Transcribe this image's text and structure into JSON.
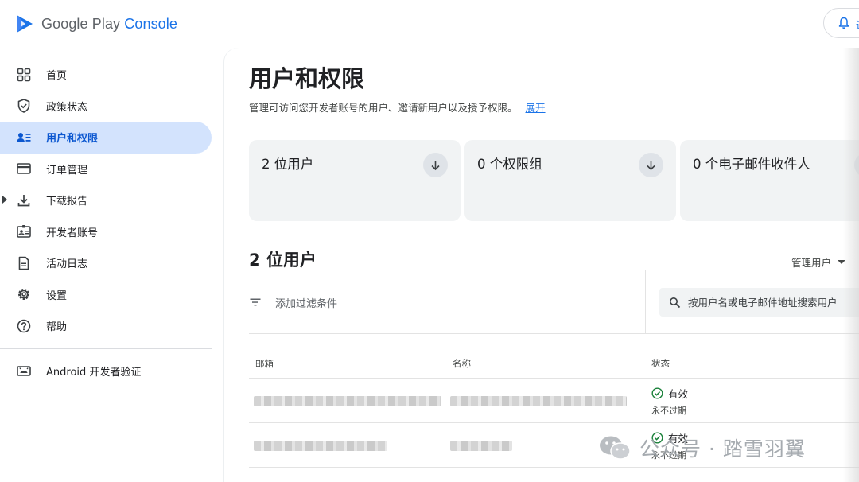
{
  "app": {
    "logo_text_main": "Google Play ",
    "logo_text_accent": "Console",
    "notification_label": "通"
  },
  "sidebar": {
    "items": [
      {
        "label": "首页",
        "icon": "grid-icon"
      },
      {
        "label": "政策状态",
        "icon": "shield-icon"
      },
      {
        "label": "用户和权限",
        "icon": "users-list-icon",
        "active": true
      },
      {
        "label": "订单管理",
        "icon": "credit-card-icon"
      },
      {
        "label": "下载报告",
        "icon": "download-icon",
        "expandable": true
      },
      {
        "label": "开发者账号",
        "icon": "id-card-icon"
      },
      {
        "label": "活动日志",
        "icon": "document-icon"
      },
      {
        "label": "设置",
        "icon": "gear-icon"
      },
      {
        "label": "帮助",
        "icon": "help-icon"
      }
    ],
    "footer_item": {
      "label": "Android 开发者验证",
      "icon": "android-icon"
    }
  },
  "main": {
    "title": "用户和权限",
    "description": "管理可访问您开发者账号的用户、邀请新用户以及授予权限。",
    "expand_link": "展开",
    "cards": [
      {
        "title": "2 位用户"
      },
      {
        "title": "0 个权限组"
      },
      {
        "title": "0 个电子邮件收件人"
      }
    ],
    "section_title": "2 位用户",
    "manage_users": "管理用户",
    "filter_label": "添加过滤条件",
    "search_placeholder": "按用户名或电子邮件地址搜索用户",
    "table": {
      "columns": [
        "邮箱",
        "名称",
        "状态"
      ],
      "rows": [
        {
          "status": "有效",
          "expiry": "永不过期"
        },
        {
          "status": "有效",
          "expiry": "永不过期"
        }
      ]
    }
  },
  "watermark": {
    "text": "公众号 · 踏雪羽翼"
  },
  "colors": {
    "accent": "#1a73e8",
    "active_bg": "#d3e3fd",
    "status_green": "#188038"
  }
}
